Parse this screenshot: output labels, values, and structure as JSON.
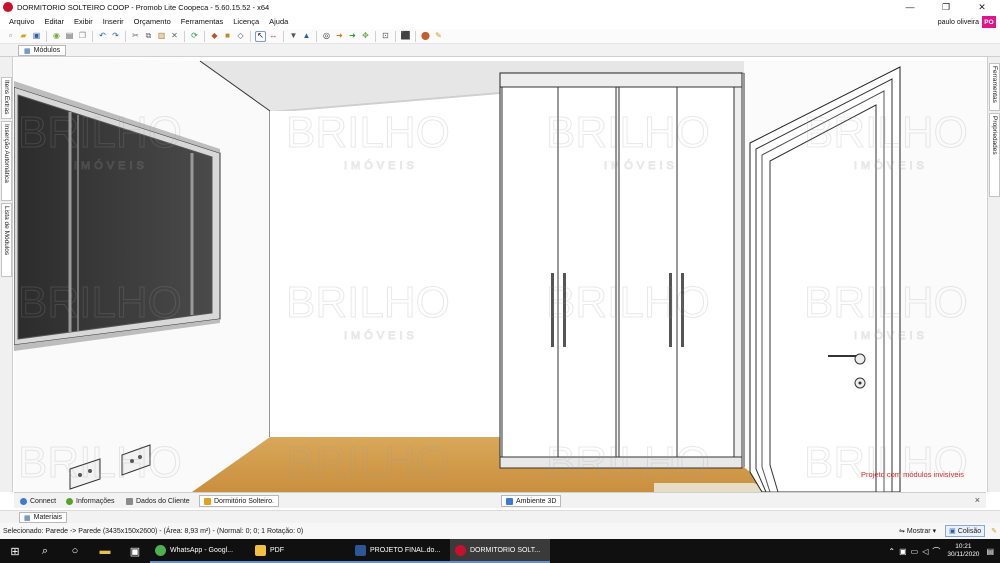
{
  "window": {
    "title": "DORMITORIO SOLTEIRO COOP - Promob Lite Coopeca - 5.60.15.52 - x64",
    "controls": [
      "—",
      "❐",
      "✕"
    ]
  },
  "menu": [
    "Arquivo",
    "Editar",
    "Exibir",
    "Inserir",
    "Orçamento",
    "Ferramentas",
    "Licença",
    "Ajuda"
  ],
  "user": {
    "name": "paulo oliveira",
    "initials": "PO",
    "avatar_color": "#e0158c"
  },
  "toolbar_icons": [
    "new-icon",
    "open-icon",
    "save-icon",
    "sep",
    "render-icon",
    "print-icon",
    "copy-icon",
    "sep",
    "undo-icon",
    "redo-icon",
    "sep",
    "cut-icon",
    "copy2-icon",
    "paste-icon",
    "delete-icon",
    "sep",
    "refresh-icon",
    "sep",
    "shape-icon",
    "box-icon",
    "sep",
    "select-cursor-icon",
    "measure-icon",
    "sep",
    "view-icon",
    "3d-icon",
    "sep",
    "eye-icon",
    "forward-icon",
    "back-icon",
    "sep",
    "zoom-icon",
    "sep",
    "cube-icon",
    "sep",
    "paint-icon",
    "brush-icon"
  ],
  "top_tab": {
    "label": "Módulos"
  },
  "left_sidebar": [
    "Itens Extras",
    "Inserção Automática",
    "Lista de Módulos"
  ],
  "right_sidebar": [
    "Ferramentas",
    "Propriedades"
  ],
  "viewport": {
    "watermark": {
      "brand": "BRILHO",
      "sub": "IMÓVEIS"
    },
    "note": "Projeto com módulos invisíveis",
    "note_color": "#d0302a"
  },
  "bottom_tabs": [
    {
      "label": "Connect",
      "color": "#3a7bd5"
    },
    {
      "label": "Informações",
      "color": "#5aa02c"
    },
    {
      "label": "Dados do Cliente",
      "color": "#8a8a8a"
    },
    {
      "label": "Dormitório Solteiro.",
      "color": "#e0a020",
      "active": true
    },
    {
      "label": "Ambiente 3D",
      "color": "#3a7bd5",
      "active": true
    }
  ],
  "materials_tab": {
    "label": "Materiais"
  },
  "status": {
    "text": "Selecionado: Parede -> Parede (3435x150x2600) - (Área: 8,93 m²) - (Normal: 0; 0; 1 Rotação: 0)",
    "show_label": "Mostrar",
    "collision_label": "Colisão"
  },
  "taskbar": {
    "apps": [
      {
        "label": "WhatsApp - Googl...",
        "color": "#4caf50"
      },
      {
        "label": "PDF",
        "color": "#f0c040"
      },
      {
        "label": "PROJETO FINAL.do...",
        "color": "#2b5797"
      },
      {
        "label": "DORMITORIO SOLT...",
        "color": "#c8102e",
        "active": true
      }
    ],
    "time": "10:21",
    "date": "30/11/2020"
  }
}
